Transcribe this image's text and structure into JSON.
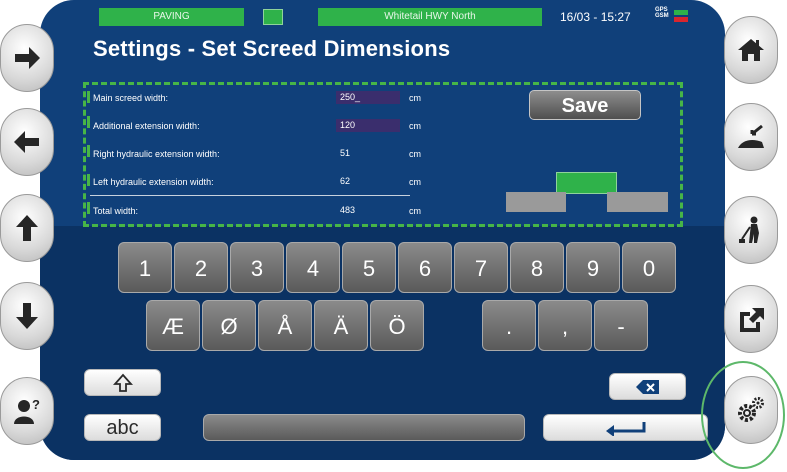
{
  "status_bar": {
    "mode": "PAVING",
    "road": "Whitetail HWY North",
    "datetime": "16/03 - 15:27",
    "gps_label": "GPS",
    "gsm_label": "GSM",
    "gps_color": "#2fb24a",
    "gsm_color": "#d9262e"
  },
  "title": "Settings  -  Set Screed Dimensions",
  "fields": [
    {
      "label": "Main screed width:",
      "value": "250_",
      "unit": "cm"
    },
    {
      "label": "Additional extension width:",
      "value": "120",
      "unit": "cm"
    },
    {
      "label": "Right hydraulic extension width:",
      "value": "51",
      "unit": "cm"
    },
    {
      "label": "Left hydraulic extension width:",
      "value": "62",
      "unit": "cm"
    },
    {
      "label": "Total width:",
      "value": "483",
      "unit": "cm"
    }
  ],
  "save_label": "Save",
  "keyboard": {
    "row1": [
      "1",
      "2",
      "3",
      "4",
      "5",
      "6",
      "7",
      "8",
      "9",
      "0"
    ],
    "row2": [
      "Æ",
      "Ø",
      "Å",
      "Ä",
      "Ö"
    ],
    "row2_right": [
      ".",
      ",",
      "-"
    ],
    "abc_label": "abc"
  },
  "left_nav": [
    "arrow-right-icon",
    "arrow-left-icon",
    "arrow-up-icon",
    "arrow-down-icon",
    "user-help-icon"
  ],
  "right_nav": [
    "home-icon",
    "paving-icon",
    "worker-icon",
    "export-icon",
    "settings-icon"
  ],
  "colors": {
    "accent": "#2fb24a",
    "panel": "#10407a",
    "highlight_circle": "#5db86a"
  }
}
